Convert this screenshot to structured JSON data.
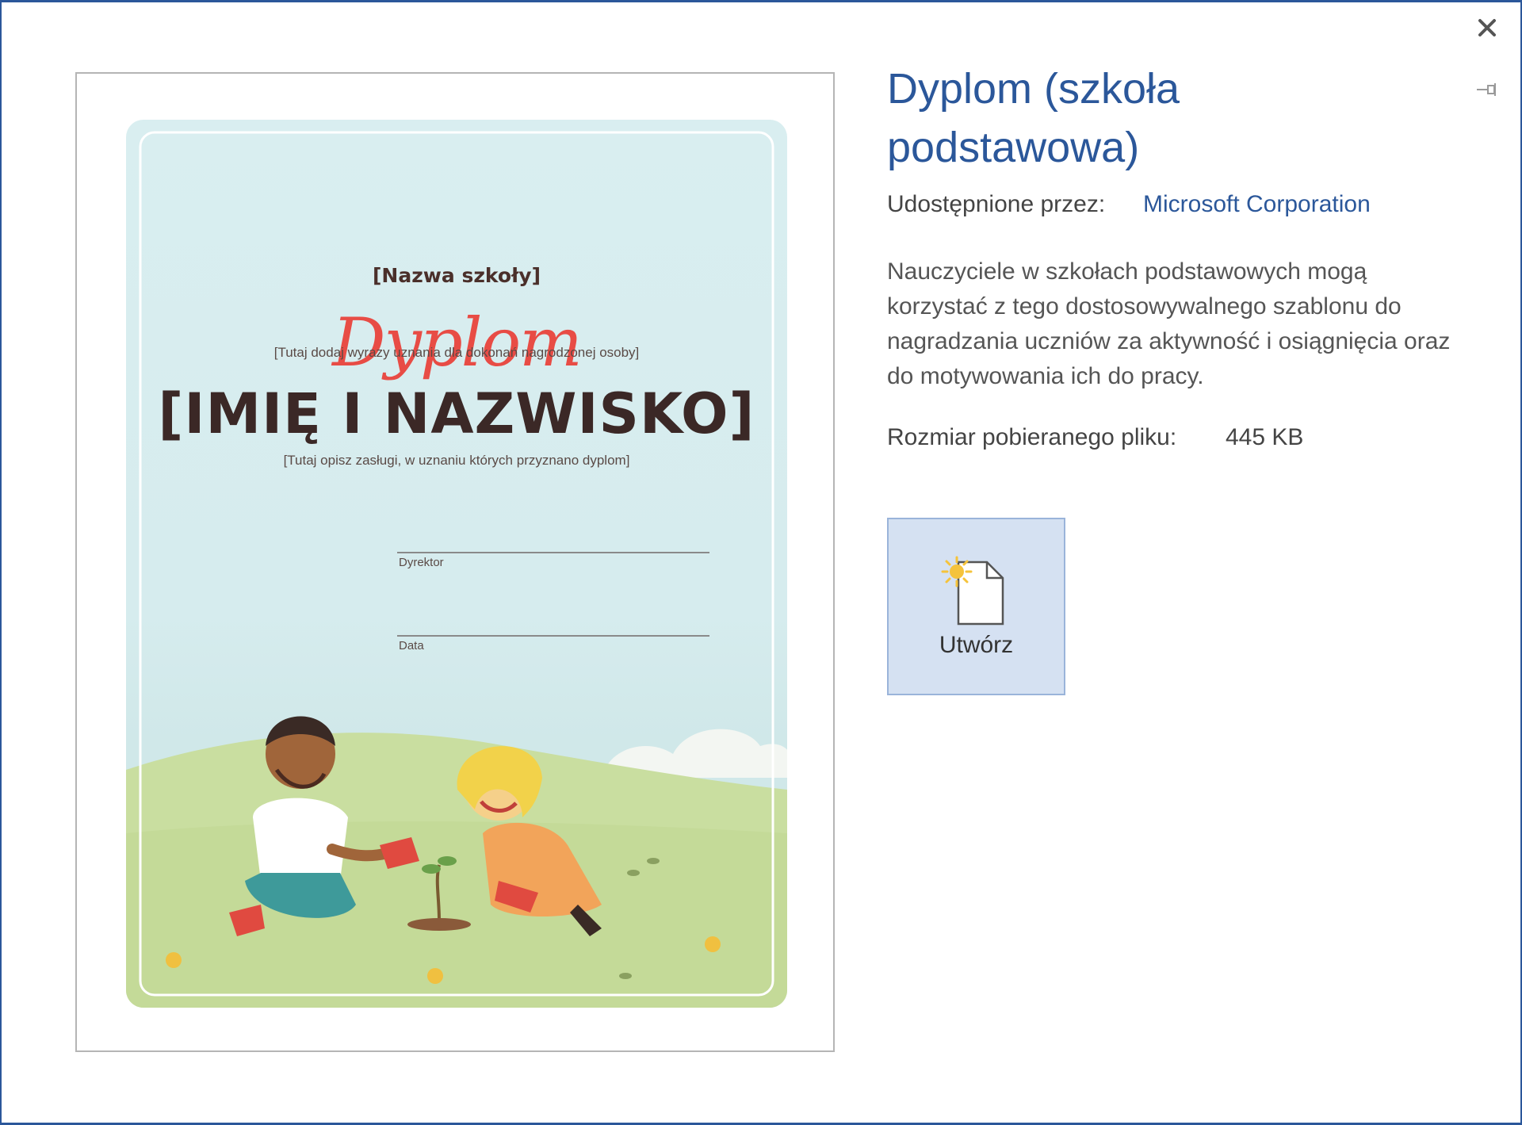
{
  "dialog": {
    "close_icon": "close-icon",
    "pin_icon": "pin-icon"
  },
  "preview": {
    "school_name": "[Nazwa szkoły]",
    "heading": "Dyplom",
    "praise_line": "[Tutaj dodaj wyrazy uznania dla dokonań nagrodzonej osoby]",
    "recipient_name": "[IMIĘ I NAZWISKO]",
    "merits_line": "[Tutaj opisz zasługi, w uznaniu których przyznano dyplom]",
    "signature_director": "Dyrektor",
    "signature_date": "Data"
  },
  "details": {
    "title": "Dyplom (szkoła podstawowa)",
    "shared_by_label": "Udostępnione przez:",
    "shared_by_value": "Microsoft Corporation",
    "description": "Nauczyciele w szkołach podstawowych mogą korzystać z tego dostosowywalnego szablonu do nagradzania uczniów za aktywność i osiągnięcia oraz do motywowania ich do pracy.",
    "download_size_label": "Rozmiar pobieranego pliku:",
    "download_size_value": "445 KB",
    "create_button_label": "Utwórz",
    "create_button_icon": "new-document-icon"
  },
  "colors": {
    "accent": "#2b579a",
    "button_bg": "#d5e1f2",
    "button_border": "#9ab4da",
    "certificate_sky": "#d6ecee",
    "certificate_grass": "#c9dea0",
    "script_red": "#e84c45"
  }
}
